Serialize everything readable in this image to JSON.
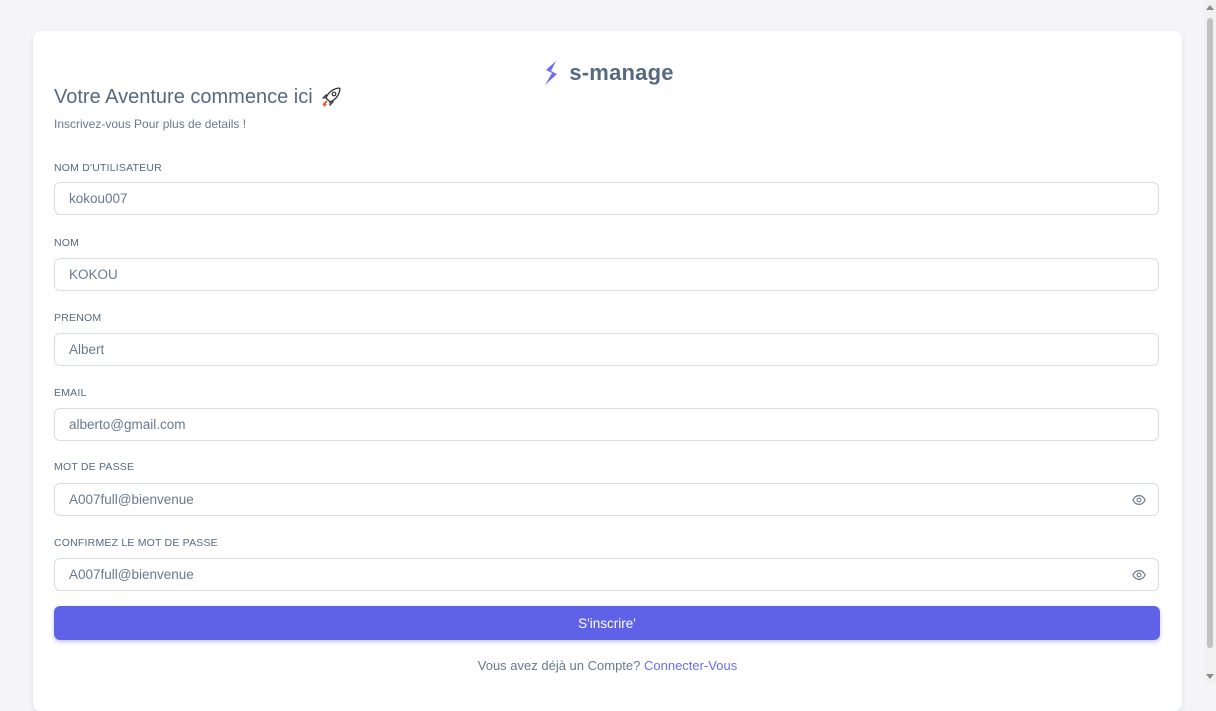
{
  "brand": {
    "name": "s-manage",
    "logo_icon": "s-logo-icon",
    "logo_color": "#696cff"
  },
  "header": {
    "title": "Votre Aventure commence ici",
    "title_icon": "rocket-icon",
    "subtitle": "Inscrivez-vous Pour plus de details !"
  },
  "form": {
    "username": {
      "label": "NOM D'UTILISATEUR",
      "value": "kokou007"
    },
    "lastname": {
      "label": "NOM",
      "value": "KOKOU"
    },
    "firstname": {
      "label": "PRENOM",
      "value": "Albert"
    },
    "email": {
      "label": "EMAIL",
      "value": "alberto@gmail.com"
    },
    "password": {
      "label": "MOT DE PASSE",
      "value": "A007full@bienvenue",
      "toggle_icon": "eye-icon"
    },
    "confirm_password": {
      "label": "CONFIRMEZ LE MOT DE PASSE",
      "value": "A007full@bienvenue",
      "toggle_icon": "eye-icon"
    },
    "submit_label": "S'inscrire'"
  },
  "footer": {
    "prompt": "Vous avez déjà un Compte?",
    "link_label": "Connecter-Vous"
  },
  "colors": {
    "accent": "#696cff",
    "button": "#5f61e6",
    "background": "#f5f5f9"
  }
}
